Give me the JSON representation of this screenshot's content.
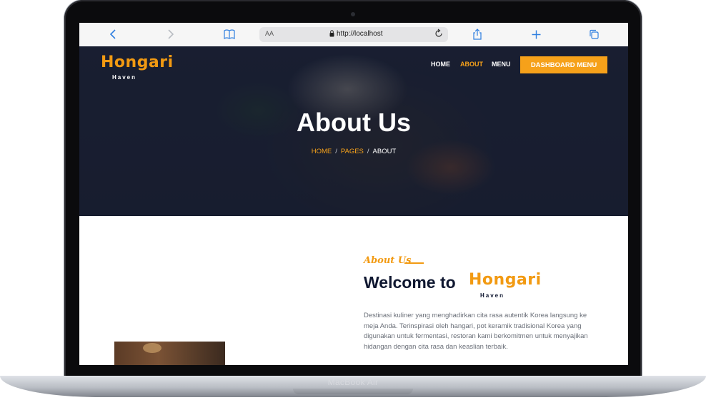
{
  "device": {
    "label": "MacBook Air"
  },
  "browser": {
    "font_size_label": "AA",
    "url": "http://localhost"
  },
  "site": {
    "logo": {
      "title": "Hongari",
      "subtitle": "Haven"
    },
    "nav": [
      {
        "label": "HOME",
        "active": false
      },
      {
        "label": "ABOUT",
        "active": true
      },
      {
        "label": "MENU",
        "active": false
      }
    ],
    "cta_label": "DASHBOARD MENU"
  },
  "hero": {
    "title": "About Us",
    "breadcrumb": {
      "home": "HOME",
      "pages": "PAGES",
      "current": "ABOUT"
    }
  },
  "about": {
    "label": "About Us",
    "heading": "Welcome to",
    "description": "Destinasi kuliner yang menghadirkan cita rasa autentik Korea langsung ke meja Anda. Terinspirasi oleh hangari, pot keramik tradisional Korea yang digunakan untuk fermentasi, restoran kami berkomitmen untuk menyajikan hidangan dengan cita rasa dan keaslian terbaik."
  },
  "colors": {
    "accent": "#f6a11a",
    "navy": "#0f1730"
  }
}
